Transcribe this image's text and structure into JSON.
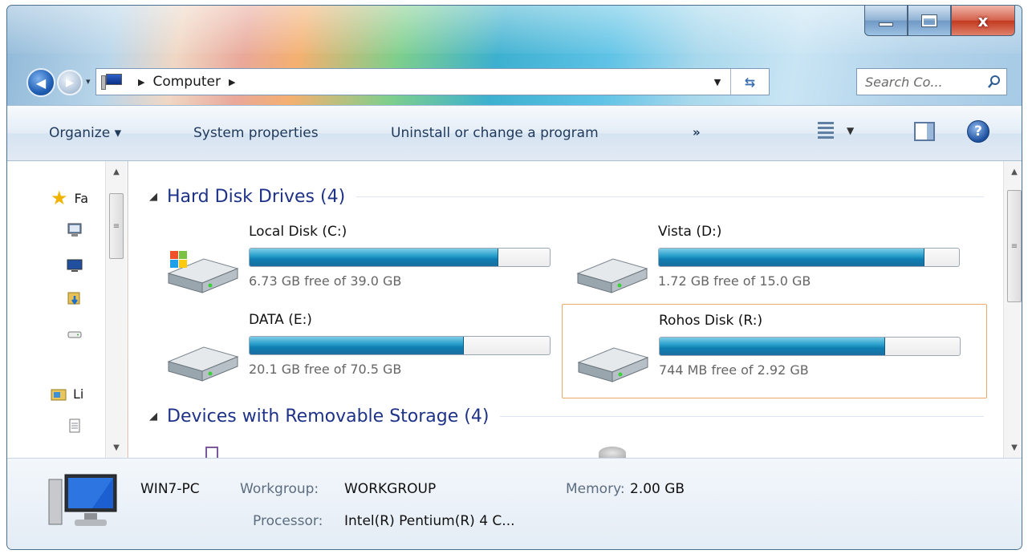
{
  "window": {
    "caption": {
      "minimize_icon": "minimize-icon",
      "maximize_icon": "maximize-icon",
      "close_glyph": "x"
    }
  },
  "nav": {
    "address_location": "Computer",
    "search_placeholder": "Search Co...",
    "forward_symbol": "▶",
    "back_symbol": "◀"
  },
  "toolbar": {
    "organize_label": "Organize ▾",
    "system_properties_label": "System properties",
    "uninstall_label": "Uninstall or change a program",
    "more_label": "»",
    "help_label": "?"
  },
  "navpane": {
    "favorites_label": "Fa",
    "libraries_label": "Li"
  },
  "groups": {
    "hard_disks": "Hard Disk Drives (4)",
    "removable": "Devices with Removable Storage (4)"
  },
  "drives": [
    {
      "name": "Local Disk (C:)",
      "free_text": "6.73 GB free of 39.0 GB",
      "used_fraction": 0.83,
      "icon": "windows-drive-icon"
    },
    {
      "name": "Vista (D:)",
      "free_text": "1.72 GB free of 15.0 GB",
      "used_fraction": 0.885,
      "icon": "hard-drive-icon"
    },
    {
      "name": "DATA (E:)",
      "free_text": "20.1 GB free of 70.5 GB",
      "used_fraction": 0.715,
      "icon": "hard-drive-icon"
    },
    {
      "name": "Rohos Disk (R:)",
      "free_text": "744 MB free of 2.92 GB",
      "used_fraction": 0.75,
      "icon": "hard-drive-icon"
    }
  ],
  "details": {
    "computer_name": "WIN7-PC",
    "workgroup_label": "Workgroup:",
    "workgroup_value": "WORKGROUP",
    "memory_label": "Memory:",
    "memory_value": "2.00 GB",
    "processor_label": "Processor:",
    "processor_value": "Intel(R) Pentium(R) 4 C..."
  },
  "colors": {
    "accent": "#1e3287",
    "selection_border": "#e8a96a",
    "bar_fill": "#1a8fc0"
  }
}
